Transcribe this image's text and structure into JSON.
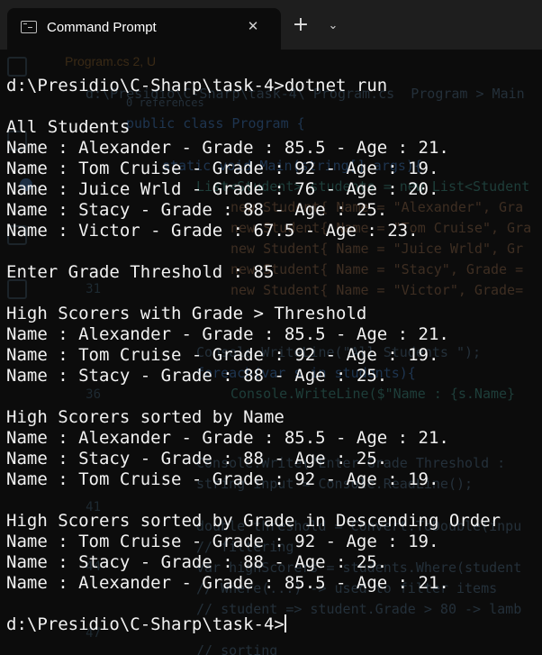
{
  "window": {
    "tab_title": "Command Prompt",
    "close_glyph": "✕",
    "new_tab_glyph": "+",
    "dropdown_glyph": "⌄"
  },
  "background_editor": {
    "tab_label": "Program.cs 2, U",
    "line_numbers": [
      "31",
      "36",
      "41",
      "44",
      "47"
    ],
    "code_lines": [
      "d:\\Presidio\\C-Sharp\\task-4\\ Program.cs  Program > Main",
      "0 references",
      "public class Program {",
      "static void Main(string[] args){",
      "List<Student> students = new List<Student",
      "new Student{ Name = \"Alexander\", Gra",
      "new Student{ Name = \"Tom Cruise\", Gra",
      "new Student{ Name = \"Juice Wrld\", Gr",
      "new Student{ Name = \"Stacy\", Grade =",
      "new Student{ Name = \"Victor\", Grade=",
      "Console.WriteLine(\"All Students \");",
      "foreach(var s in students){",
      "Console.WriteLine($\"Name : {s.Name}",
      "Console.Write(\"Enter Grade Threshold :",
      "string input = Console.ReadLine();",
      "double threshold = Convert.ToDouble(inpu",
      "// filtering",
      "var highScorers = students.Where(student",
      "// Where(...) -> used to filter items",
      "// student => student.Grade > 80 -> lamb",
      "// sorting"
    ]
  },
  "terminal": {
    "prompt": "d:\\Presidio\\C-Sharp\\task-4>",
    "lines": [
      "d:\\Presidio\\C-Sharp\\task-4>dotnet run",
      "",
      "All Students",
      "Name : Alexander - Grade : 85.5 - Age : 21.",
      "Name : Tom Cruise - Grade : 92 - Age : 19.",
      "Name : Juice Wrld - Grade : 76 - Age : 20.",
      "Name : Stacy - Grade : 88 - Age : 25.",
      "Name : Victor - Grade : 67.5 - Age : 23.",
      "",
      "Enter Grade Threshold : 85",
      "",
      "High Scorers with Grade > Threshold",
      "Name : Alexander - Grade : 85.5 - Age : 21.",
      "Name : Tom Cruise - Grade : 92 - Age : 19.",
      "Name : Stacy - Grade : 88 - Age : 25.",
      "",
      "High Scorers sorted by Name",
      "Name : Alexander - Grade : 85.5 - Age : 21.",
      "Name : Stacy - Grade : 88 - Age : 25.",
      "Name : Tom Cruise - Grade : 92 - Age : 19.",
      "",
      "High Scorers sorted by Grade in Descending Order",
      "Name : Tom Cruise - Grade : 92 - Age : 19.",
      "Name : Stacy - Grade : 88 - Age : 25.",
      "Name : Alexander - Grade : 85.5 - Age : 21.",
      ""
    ]
  },
  "colors": {
    "terminal_bg": "#0c0c0c",
    "terminal_fg": "#f2f2f2",
    "tabstrip_bg": "#1e1e1e"
  }
}
